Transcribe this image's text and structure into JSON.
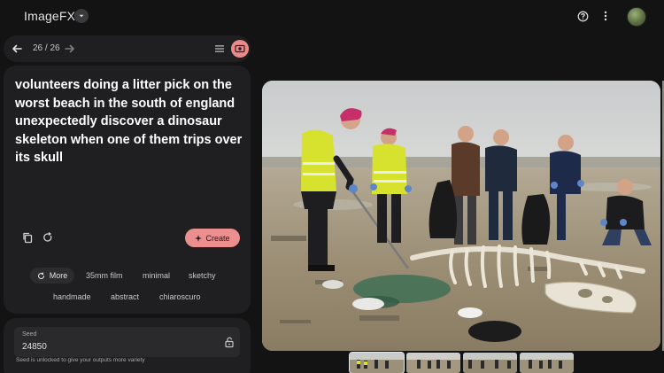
{
  "app": {
    "title": "ImageFX"
  },
  "nav": {
    "counter": "26 / 26"
  },
  "prompt": {
    "text": "volunteers doing a litter pick on the worst beach in the south of england unexpectedly discover a dinosaur skeleton when one of them trips over its skull"
  },
  "actions": {
    "create_label": "Create"
  },
  "chips": {
    "more_label": "More",
    "items": [
      "35mm film",
      "minimal",
      "sketchy",
      "handmade",
      "abstract",
      "chiaroscuro"
    ]
  },
  "seed": {
    "label": "Seed",
    "value": "24850",
    "note": "Seed is unlocked to give your outputs more variety"
  },
  "icons": {
    "help": "help-icon",
    "menu": "more-vert-icon",
    "back": "arrow-back-icon",
    "forward": "arrow-forward-icon",
    "grid": "grid-view-icon",
    "camera": "image-mode-icon",
    "copy": "copy-icon",
    "reset": "reset-icon",
    "sparkle": "sparkle-icon",
    "lock": "unlock-icon"
  },
  "colors": {
    "background": "#131314",
    "panel": "#1f1f21",
    "accent": "#ec8f8f"
  }
}
